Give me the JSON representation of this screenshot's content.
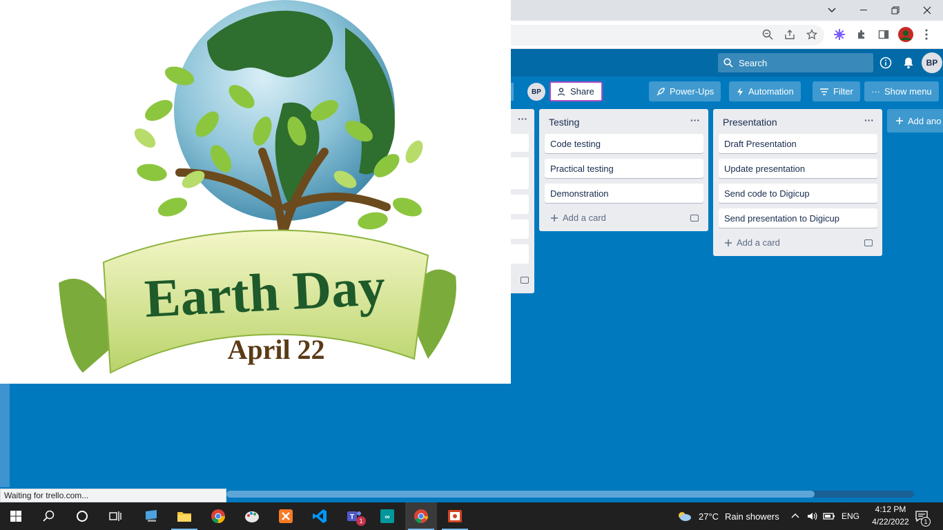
{
  "browser": {
    "window_controls": [
      "chevron-down",
      "minimize",
      "restore",
      "close"
    ],
    "toolbar_icons": [
      "zoom-icon",
      "share-page-icon",
      "bookmark-star-icon",
      "extension-icon",
      "puzzle-icon",
      "side-panel-icon",
      "profile-avatar",
      "more-icon"
    ]
  },
  "trello": {
    "search_placeholder": "Search",
    "user_initials": "BP",
    "board": {
      "share_label": "Share",
      "powerups_label": "Power-Ups",
      "automation_label": "Automation",
      "filter_label": "Filter",
      "show_menu_label": "Show menu",
      "member_initials": "BP"
    },
    "lists": [
      {
        "title": "Testing",
        "cards": [
          "Code testing",
          "Practical testing",
          "Demonstration"
        ],
        "add_card_label": "Add a card"
      },
      {
        "title": "Presentation",
        "cards": [
          "Draft Presentation",
          "Update presentation",
          "Send code to Digicup",
          "Send presentation to Digicup"
        ],
        "add_card_label": "Add a card"
      }
    ],
    "add_list_label": "Add ano",
    "list_menu_glyph": "···"
  },
  "earth_day": {
    "title": "Earth Day",
    "date": "April 22"
  },
  "status_bar": {
    "text": "Waiting for trello.com..."
  },
  "taskbar": {
    "weather_temp": "27°C",
    "weather_desc": "Rain showers",
    "language": "ENG",
    "time": "4:12 PM",
    "date": "4/22/2022",
    "notification_count": "1",
    "teams_badge": "1"
  },
  "colors": {
    "trello_blue": "#0079bf",
    "header_blue": "#026aa7",
    "taskbar": "#202020"
  }
}
